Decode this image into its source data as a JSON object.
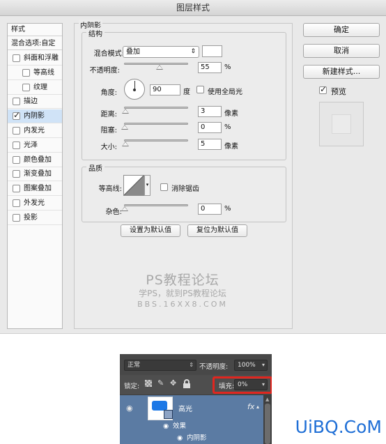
{
  "dialog": {
    "title": "图层样式",
    "left": {
      "header": "样式",
      "blend_options": "混合选项:自定",
      "items": [
        {
          "label": "斜面和浮雕",
          "checked": false,
          "indent": false,
          "selected": false
        },
        {
          "label": "等高线",
          "checked": false,
          "indent": true,
          "selected": false
        },
        {
          "label": "纹理",
          "checked": false,
          "indent": true,
          "selected": false
        },
        {
          "label": "描边",
          "checked": false,
          "indent": false,
          "selected": false
        },
        {
          "label": "内阴影",
          "checked": true,
          "indent": false,
          "selected": true
        },
        {
          "label": "内发光",
          "checked": false,
          "indent": false,
          "selected": false
        },
        {
          "label": "光泽",
          "checked": false,
          "indent": false,
          "selected": false
        },
        {
          "label": "颜色叠加",
          "checked": false,
          "indent": false,
          "selected": false
        },
        {
          "label": "渐变叠加",
          "checked": false,
          "indent": false,
          "selected": false
        },
        {
          "label": "图案叠加",
          "checked": false,
          "indent": false,
          "selected": false
        },
        {
          "label": "外发光",
          "checked": false,
          "indent": false,
          "selected": false
        },
        {
          "label": "投影",
          "checked": false,
          "indent": false,
          "selected": false
        }
      ],
      "check_mark": "✓"
    },
    "inner_shadow": {
      "section_title": "内阴影",
      "structure_title": "结构",
      "blend_mode_label": "混合模式:",
      "blend_mode_value": "叠加",
      "opacity_label": "不透明度:",
      "opacity_value": "55",
      "opacity_level": 0.55,
      "percent": "%",
      "angle_label": "角度:",
      "angle_value": "90",
      "degree_unit": "度",
      "global_light_label": "使用全局光",
      "distance_label": "距离:",
      "distance_value": "3",
      "choke_label": "阻塞:",
      "choke_value": "0",
      "size_label": "大小:",
      "size_value": "5",
      "pixel_unit": "像素",
      "quality_title": "品质",
      "contour_label": "等高线:",
      "antialias_label": "消除锯齿",
      "noise_label": "杂色:",
      "noise_value": "0",
      "set_default": "设置为默认值",
      "reset_default": "复位为默认值"
    },
    "buttons": {
      "ok": "确定",
      "cancel": "取消",
      "new_style": "新建样式...",
      "preview_label": "预览",
      "preview_checked": true
    },
    "watermark": {
      "line1": "PS教程论坛",
      "line2": "学PS，就到PS教程论坛",
      "line3": "BBS.16XX8.COM"
    }
  },
  "layers_panel": {
    "blend_mode": "正常",
    "opacity_label": "不透明度:",
    "opacity_value": "100%",
    "lock_label": "锁定:",
    "fill_label": "填充:",
    "fill_value": "0%",
    "layer_name": "高光",
    "fx": "fx",
    "effects_label": "效果",
    "effect_item": "内阴影"
  },
  "brand": "UiBQ.CoM",
  "colors": {
    "highlight_box": "#e0261f",
    "layer_selected": "#5b7ba3",
    "thumbnail_shape": "#1c78e6",
    "brand": "#1f6fd6"
  }
}
